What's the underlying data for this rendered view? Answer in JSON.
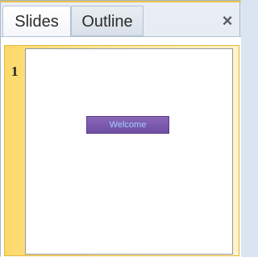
{
  "tabs": [
    {
      "label": "Slides"
    },
    {
      "label": "Outline"
    }
  ],
  "close_label": "x",
  "slide": {
    "number": "1",
    "title_box": "Welcome"
  },
  "colors": {
    "highlight": "#ffe898",
    "title_box_fill": "#7a58ac",
    "title_box_text": "#9fd0ff"
  }
}
